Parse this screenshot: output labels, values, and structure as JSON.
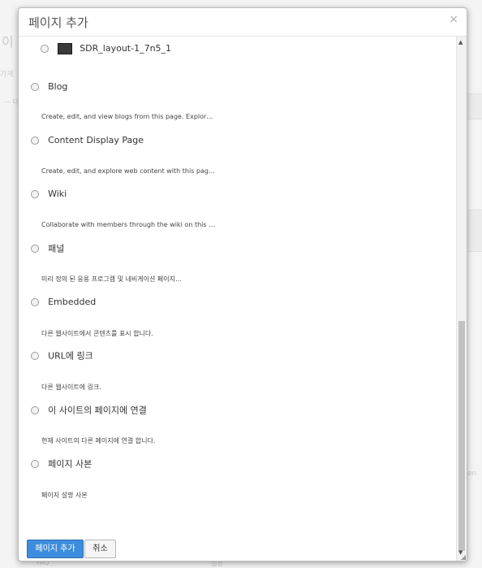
{
  "background": {
    "fragments": [
      "이",
      "가개",
      "— 다",
      "ㅅ",
      "en",
      "설정",
      "FAQ"
    ]
  },
  "modal": {
    "title": "페이지 추가",
    "close_glyph": "×",
    "scroll_position": 0.72
  },
  "options": [
    {
      "label": "SDR_layout-1_7n5_1",
      "description": "",
      "has_thumbnail": true
    },
    {
      "label": "Blog",
      "description": "Create, edit, and view blogs from this page. Explor…"
    },
    {
      "label": "Content Display Page",
      "description": "Create, edit, and explore web content with this pag…"
    },
    {
      "label": "Wiki",
      "description": "Collaborate with members through the wiki on this …"
    },
    {
      "label": "패널",
      "description": "미리 정의 된 응용 프로그램 및 네비게이션 페이지…"
    },
    {
      "label": "Embedded",
      "description": "다른 웹사이트에서 콘텐츠를 표시 합니다."
    },
    {
      "label": "URL에 링크",
      "description": "다른 웹사이트에 링크."
    },
    {
      "label": "이 사이트의 페이지에 연결",
      "description": "현재 사이트의 다른 페이지에 연결 합니다."
    },
    {
      "label": "페이지 사본",
      "description": "페이지 설명 사본"
    }
  ],
  "buttons": {
    "add_page": "페이지 추가",
    "cancel": "취소"
  },
  "colors": {
    "primary": "#3e8ddd",
    "overlay": "#f4f4f4"
  }
}
